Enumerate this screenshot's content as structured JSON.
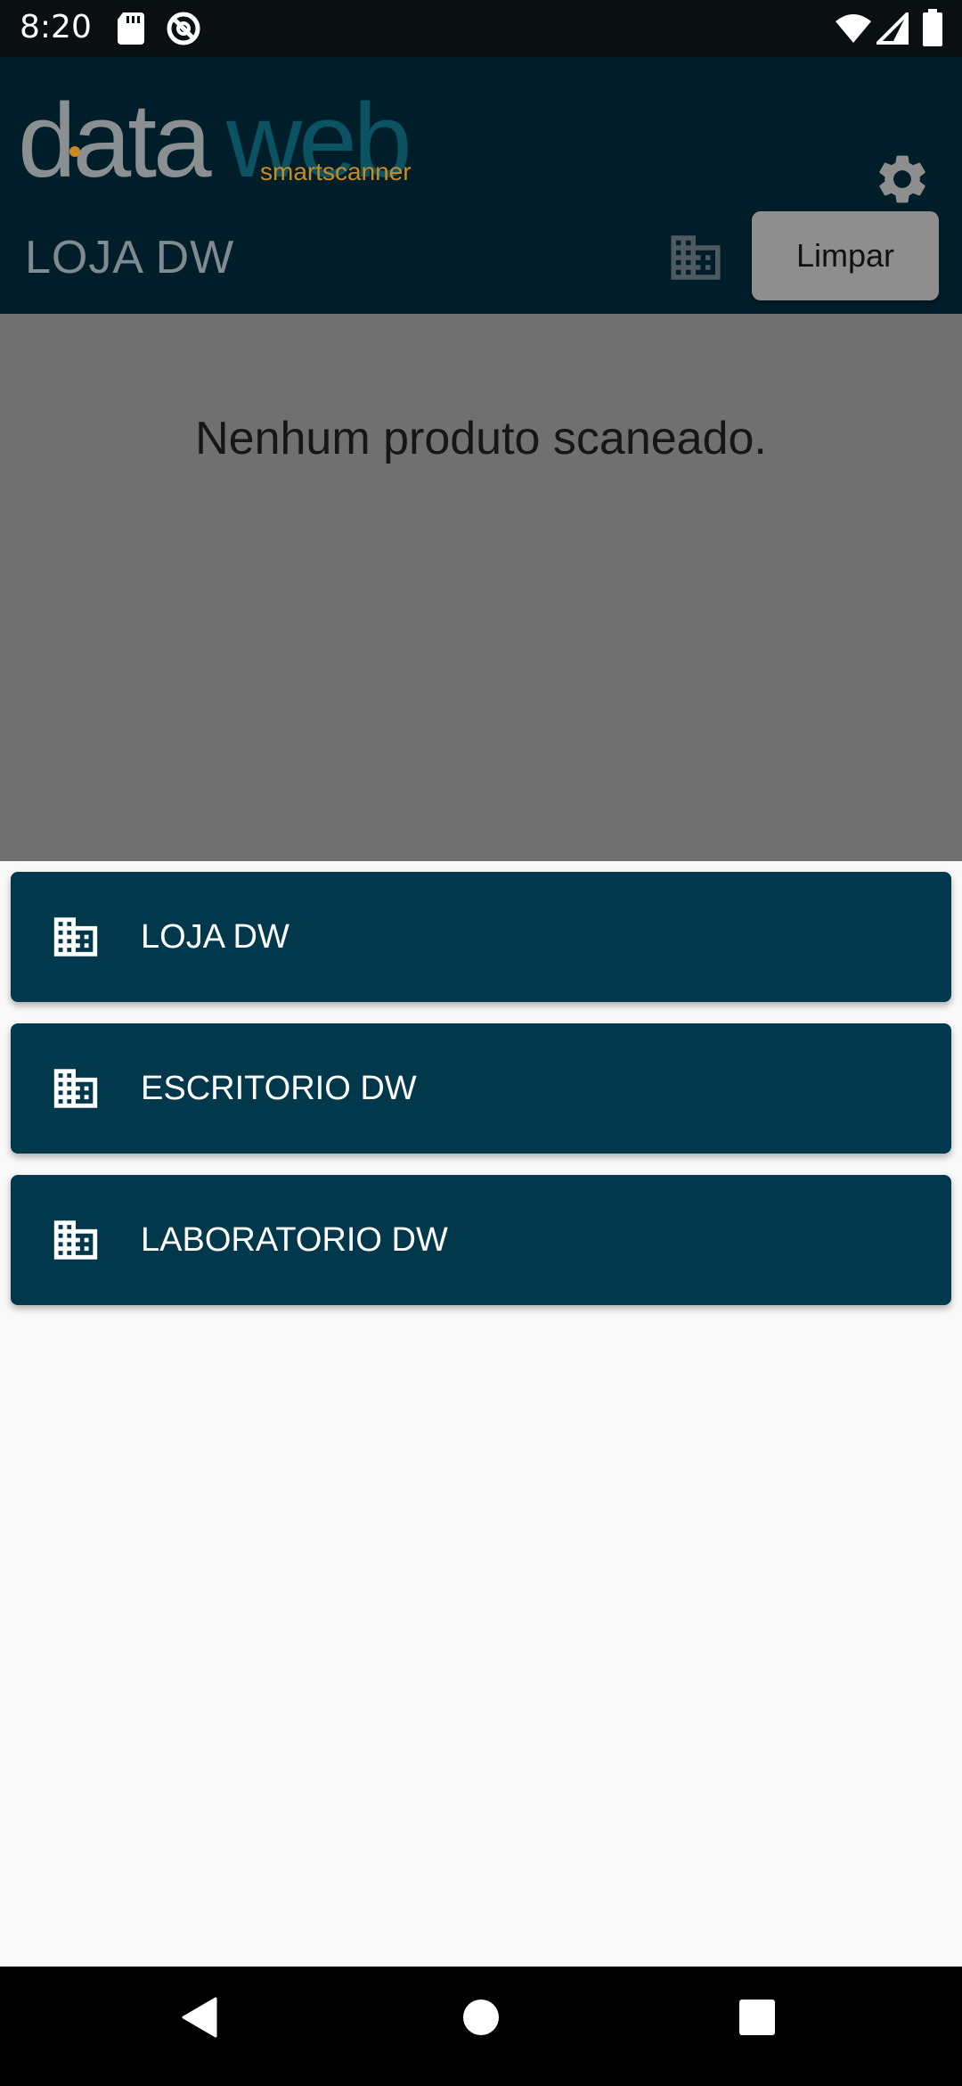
{
  "status_bar": {
    "time": "8:20",
    "icons": [
      "sd-card-icon",
      "no-entry-icon",
      "wifi-icon",
      "signal-icon",
      "battery-icon"
    ]
  },
  "header": {
    "logo": {
      "primary": "data",
      "secondary": "web",
      "tagline": "smartscanner"
    },
    "store_title": "LOJA DW",
    "clear_label": "Limpar"
  },
  "content": {
    "empty_message": "Nenhum produto scaneado."
  },
  "store_list": [
    {
      "label": "LOJA DW",
      "icon": "building-icon"
    },
    {
      "label": "ESCRITORIO DW",
      "icon": "building-icon"
    },
    {
      "label": "LABORATORIO DW",
      "icon": "building-icon"
    }
  ],
  "colors": {
    "header_bg": "#001e2a",
    "accent_teal": "#0b5263",
    "accent_orange": "#c98a22",
    "list_item_bg": "#01384c",
    "overlay_bg": "#707070"
  },
  "nav_bar": {
    "icons": [
      "back-icon",
      "home-icon",
      "recents-icon"
    ]
  }
}
